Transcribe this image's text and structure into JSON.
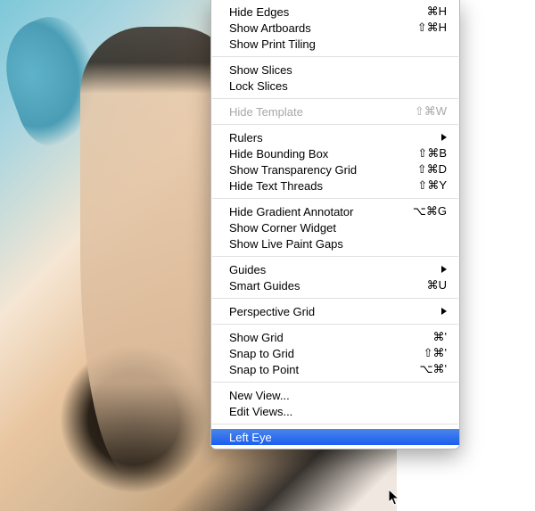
{
  "menu": {
    "groups": [
      [
        {
          "label": "Hide Edges",
          "shortcut": "⌘H",
          "disabled": false,
          "submenu": false,
          "highlighted": false,
          "name": "menu-hide-edges"
        },
        {
          "label": "Show Artboards",
          "shortcut": "⇧⌘H",
          "disabled": false,
          "submenu": false,
          "highlighted": false,
          "name": "menu-show-artboards"
        },
        {
          "label": "Show Print Tiling",
          "shortcut": "",
          "disabled": false,
          "submenu": false,
          "highlighted": false,
          "name": "menu-show-print-tiling"
        }
      ],
      [
        {
          "label": "Show Slices",
          "shortcut": "",
          "disabled": false,
          "submenu": false,
          "highlighted": false,
          "name": "menu-show-slices"
        },
        {
          "label": "Lock Slices",
          "shortcut": "",
          "disabled": false,
          "submenu": false,
          "highlighted": false,
          "name": "menu-lock-slices"
        }
      ],
      [
        {
          "label": "Hide Template",
          "shortcut": "⇧⌘W",
          "disabled": true,
          "submenu": false,
          "highlighted": false,
          "name": "menu-hide-template"
        }
      ],
      [
        {
          "label": "Rulers",
          "shortcut": "",
          "disabled": false,
          "submenu": true,
          "highlighted": false,
          "name": "menu-rulers"
        },
        {
          "label": "Hide Bounding Box",
          "shortcut": "⇧⌘B",
          "disabled": false,
          "submenu": false,
          "highlighted": false,
          "name": "menu-hide-bounding-box"
        },
        {
          "label": "Show Transparency Grid",
          "shortcut": "⇧⌘D",
          "disabled": false,
          "submenu": false,
          "highlighted": false,
          "name": "menu-show-transparency-grid"
        },
        {
          "label": "Hide Text Threads",
          "shortcut": "⇧⌘Y",
          "disabled": false,
          "submenu": false,
          "highlighted": false,
          "name": "menu-hide-text-threads"
        }
      ],
      [
        {
          "label": "Hide Gradient Annotator",
          "shortcut": "⌥⌘G",
          "disabled": false,
          "submenu": false,
          "highlighted": false,
          "name": "menu-hide-gradient-annotator"
        },
        {
          "label": "Show Corner Widget",
          "shortcut": "",
          "disabled": false,
          "submenu": false,
          "highlighted": false,
          "name": "menu-show-corner-widget"
        },
        {
          "label": "Show Live Paint Gaps",
          "shortcut": "",
          "disabled": false,
          "submenu": false,
          "highlighted": false,
          "name": "menu-show-live-paint-gaps"
        }
      ],
      [
        {
          "label": "Guides",
          "shortcut": "",
          "disabled": false,
          "submenu": true,
          "highlighted": false,
          "name": "menu-guides"
        },
        {
          "label": "Smart Guides",
          "shortcut": "⌘U",
          "disabled": false,
          "submenu": false,
          "highlighted": false,
          "name": "menu-smart-guides"
        }
      ],
      [
        {
          "label": "Perspective Grid",
          "shortcut": "",
          "disabled": false,
          "submenu": true,
          "highlighted": false,
          "name": "menu-perspective-grid"
        }
      ],
      [
        {
          "label": "Show Grid",
          "shortcut": "⌘'",
          "disabled": false,
          "submenu": false,
          "highlighted": false,
          "name": "menu-show-grid"
        },
        {
          "label": "Snap to Grid",
          "shortcut": "⇧⌘'",
          "disabled": false,
          "submenu": false,
          "highlighted": false,
          "name": "menu-snap-to-grid"
        },
        {
          "label": "Snap to Point",
          "shortcut": "⌥⌘'",
          "disabled": false,
          "submenu": false,
          "highlighted": false,
          "name": "menu-snap-to-point"
        }
      ],
      [
        {
          "label": "New View...",
          "shortcut": "",
          "disabled": false,
          "submenu": false,
          "highlighted": false,
          "name": "menu-new-view"
        },
        {
          "label": "Edit Views...",
          "shortcut": "",
          "disabled": false,
          "submenu": false,
          "highlighted": false,
          "name": "menu-edit-views"
        }
      ],
      [
        {
          "label": "Left Eye",
          "shortcut": "",
          "disabled": false,
          "submenu": false,
          "highlighted": true,
          "name": "menu-left-eye"
        }
      ]
    ]
  }
}
